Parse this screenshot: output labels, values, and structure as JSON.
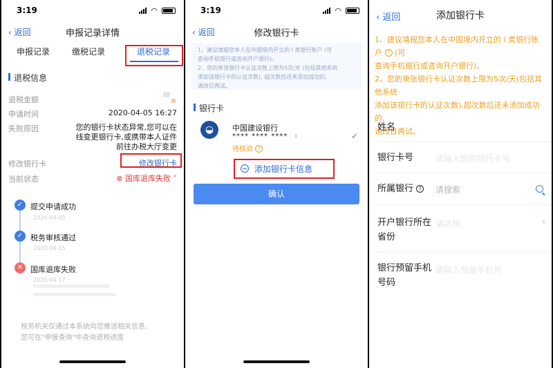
{
  "status_time": "3:19",
  "panel1": {
    "back": "返回",
    "title": "申报记录详情",
    "tabs": [
      "申报记录",
      "缴税记录",
      "退税记录"
    ],
    "section": "退税信息",
    "rows": {
      "amount_label": "退税金额",
      "apply_time_label": "申请时间",
      "apply_time": "2020-04-05 16:27",
      "reason_label": "失败原因",
      "reason": "您的银行卡状态异常,您可以在线变更银行卡,或携带本人证件前往办税大厅变更",
      "modify_label": "修改银行卡",
      "modify_link": "修改银行卡",
      "state_label": "当前状态",
      "state_value": "国库退库失败"
    },
    "timeline": [
      {
        "title": "提交申请成功",
        "date": "2020-04-05"
      },
      {
        "title": "税务审核通过",
        "date": "2020-04-15"
      },
      {
        "title": "国库退库失败",
        "date": "2020-04-17"
      }
    ],
    "note": [
      "税务机关仅通过本系统向您推送相关信息,",
      "您可在\"申报查询\"中查询退税进度"
    ]
  },
  "panel2": {
    "back": "返回",
    "title": "修改银行卡",
    "tip1": [
      "1、建议填报您本人在中国境内开立的 I 类银行账户 (可",
      "查询手机银行或咨询开户银行)。"
    ],
    "tip2": [
      "2、您的单张银行卡认证次数上限为5次/天 (包括其他系统",
      "添加该银行卡的认证次数), 超次数后还未添加成功的,",
      "请改日再试。"
    ],
    "section": "银行卡",
    "bank_name": "中国建设银行",
    "card_masked": "**** **** ****",
    "pending": "待核验",
    "add_card": "添加银行卡信息",
    "confirm": "确认"
  },
  "panel3": {
    "back": "返回",
    "title": "添加银行卡",
    "tip": [
      "1、建议填报您本人在中国境内开立的 I 类银行账户",
      "查询手机银行或咨询开户银行)。",
      "2、您的单张银行卡认证次数上限为5次/天(包括其他系统",
      "添加该银行卡的认证次数),超次数后还未添加成功的,",
      "请改日再试。"
    ],
    "fields": {
      "name": "姓名",
      "card_no": "银行卡号",
      "card_no_ph": "请输入您的银行卡号",
      "bank": "所属银行",
      "bank_ph": "请搜索",
      "branch": [
        "开户银行所在",
        "省份"
      ],
      "branch_ph": "请选择",
      "phone": [
        "银行预留手机",
        "号码"
      ],
      "phone_ph": "请输入预留手机号"
    }
  }
}
